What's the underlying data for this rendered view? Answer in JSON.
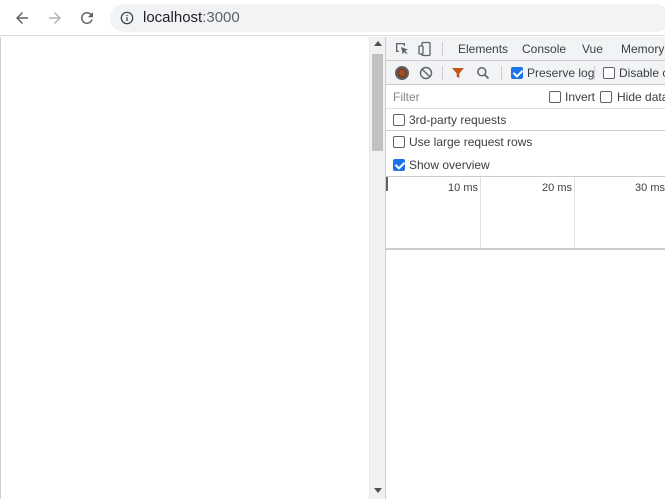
{
  "browser": {
    "url_host": "localhost",
    "url_port": ":3000",
    "icons": {
      "back": "arrow-left-icon",
      "forward": "arrow-right-icon",
      "reload": "reload-icon",
      "info": "info-circle-icon"
    }
  },
  "devtools": {
    "tabs": [
      {
        "label": "Elements"
      },
      {
        "label": "Console"
      },
      {
        "label": "Vue"
      },
      {
        "label": "Memory"
      }
    ],
    "toolbar": {
      "preserve_log_label": "Preserve log",
      "preserve_log_checked": true,
      "disable_cache_label": "Disable ca"
    },
    "filter": {
      "placeholder": "Filter",
      "invert_label": "Invert",
      "hide_data_label": "Hide data"
    },
    "options": {
      "third_party_label": "3rd-party requests",
      "large_rows_label": "Use large request rows",
      "show_overview_label": "Show overview",
      "show_overview_checked": true
    },
    "overview": {
      "ticks": [
        "10 ms",
        "20 ms",
        "30 ms"
      ]
    },
    "colors": {
      "accent": "#1a73e8",
      "record": "#7d3c1e"
    }
  }
}
